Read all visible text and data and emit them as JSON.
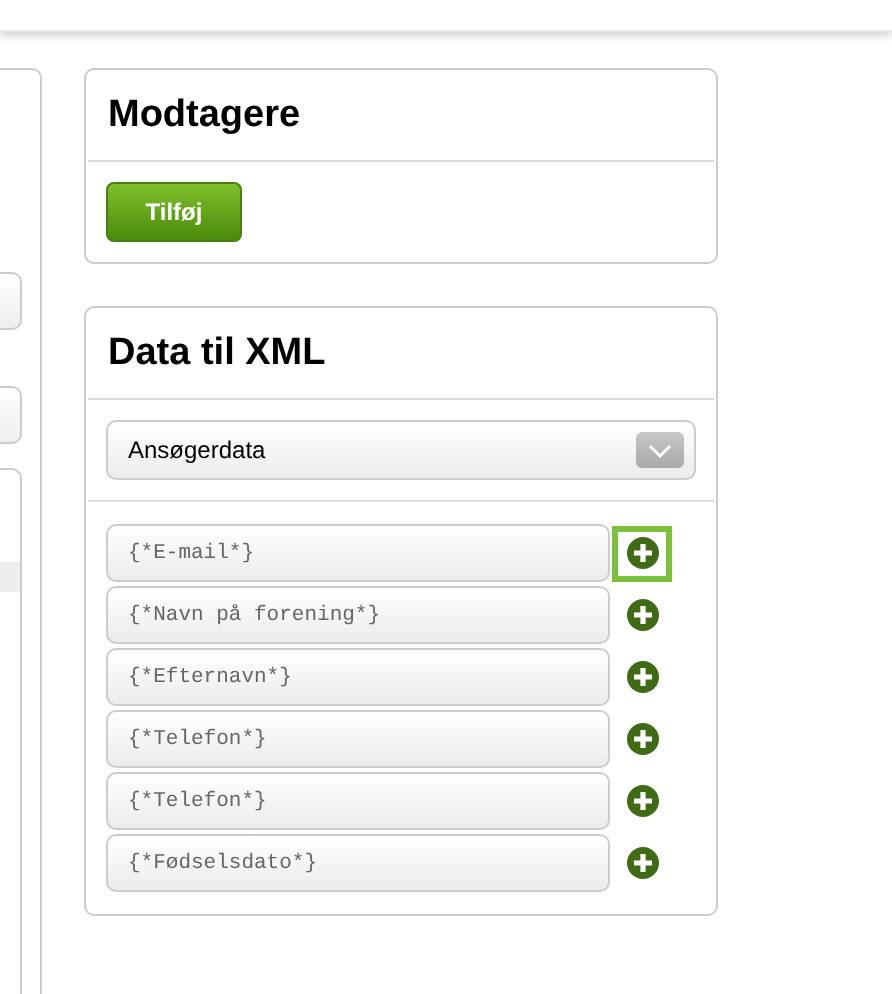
{
  "recipients": {
    "title": "Modtagere",
    "add_button": "Tilføj"
  },
  "xml_data": {
    "title": "Data til XML",
    "source_select": {
      "value": "Ansøgerdata"
    },
    "fields": [
      {
        "value": "{*E-mail*}",
        "highlighted": true
      },
      {
        "value": "{*Navn på forening*}",
        "highlighted": false
      },
      {
        "value": "{*Efternavn*}",
        "highlighted": false
      },
      {
        "value": "{*Telefon*}",
        "highlighted": false
      },
      {
        "value": "{*Telefon*}",
        "highlighted": false
      },
      {
        "value": "{*Fødselsdato*}",
        "highlighted": false
      }
    ]
  }
}
